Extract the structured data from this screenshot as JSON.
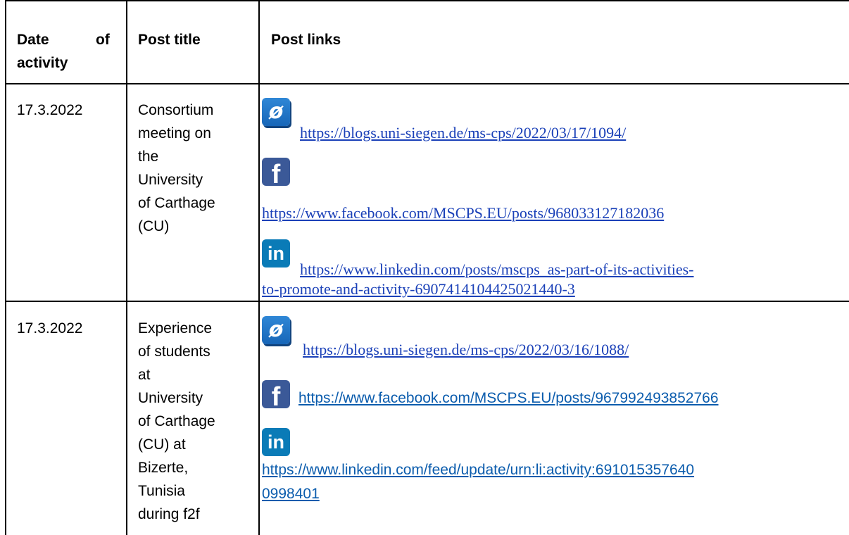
{
  "table": {
    "headers": {
      "date_line1": "Date",
      "date_line2": "of",
      "date_line3": "activity",
      "title": "Post title",
      "links": "Post links"
    },
    "rows": [
      {
        "date": "17.3.2022",
        "title_lines": [
          "Consortium",
          "meeting on",
          "the",
          "University",
          "of Carthage",
          "(CU)"
        ],
        "links": {
          "blog": "https://blogs.uni-siegen.de/ms-cps/2022/03/17/1094/",
          "facebook": "https://www.facebook.com/MSCPS.EU/posts/968033127182036",
          "linkedin_line1": "https://www.linkedin.com/posts/mscps_as-part-of-its-activities-",
          "linkedin_line2": "to-promote-and-activity-6907414104425021440-3"
        }
      },
      {
        "date": "17.3.2022",
        "title_lines": [
          "Experience",
          "of students",
          "at",
          "University",
          "of Carthage",
          "(CU) at",
          "Bizerte,",
          "Tunisia",
          "during f2f"
        ],
        "links": {
          "blog": "https://blogs.uni-siegen.de/ms-cps/2022/03/16/1088/",
          "facebook": "https://www.facebook.com/MSCPS.EU/posts/967992493852766",
          "linkedin_line1": "https://www.linkedin.com/feed/update/urn:li:activity:691015357640",
          "linkedin_line2": "0998401"
        }
      }
    ]
  },
  "icons": {
    "blog": "web-link-icon",
    "facebook": "facebook-icon",
    "linkedin": "linkedin-icon",
    "blog_glyph": "ø",
    "facebook_glyph": "f",
    "linkedin_glyph": "in"
  },
  "colors": {
    "link_blue": "#1a40b8",
    "facebook_blue": "#3b5998",
    "linkedin_blue": "#0a7bb7",
    "weblink_blue": "#1f74c9"
  }
}
